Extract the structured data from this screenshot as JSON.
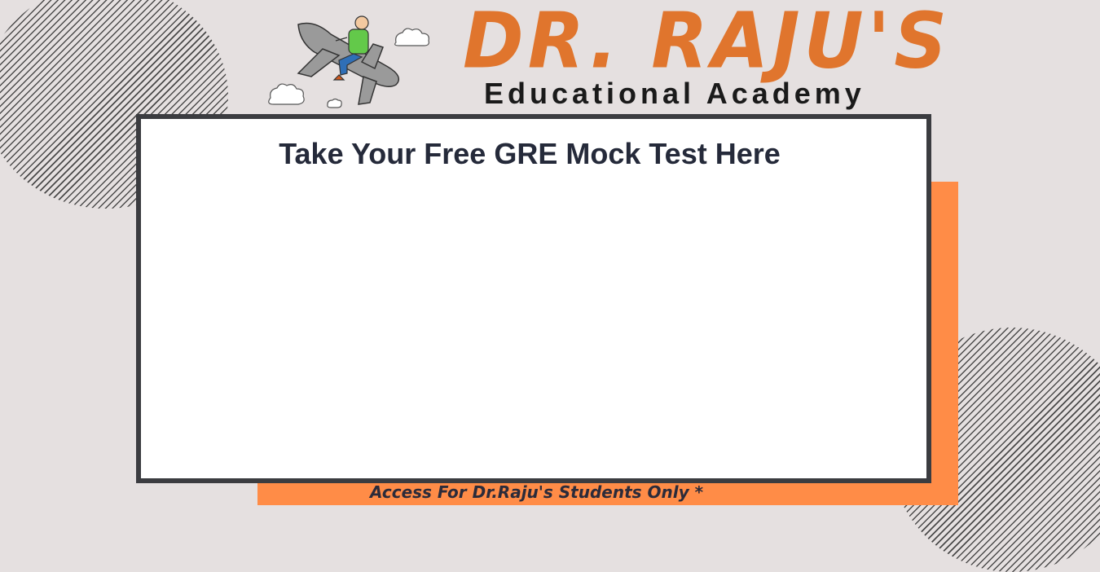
{
  "header": {
    "brand_title": "DR. RAJU'S",
    "brand_subtitle": "Educational Academy"
  },
  "main": {
    "title": "Take Your Free GRE Mock Test Here"
  },
  "footer": {
    "note": "Access For Dr.Raju's Students Only *"
  },
  "colors": {
    "background": "#e5e0e0",
    "brand_orange": "#e0752d",
    "panel_orange": "#ff8c47",
    "frame_dark": "#3b3c40",
    "title_navy": "#252a3a"
  },
  "icons": {
    "logo": "pilot-on-airplane-logo",
    "clouds": "cloud-icon"
  }
}
